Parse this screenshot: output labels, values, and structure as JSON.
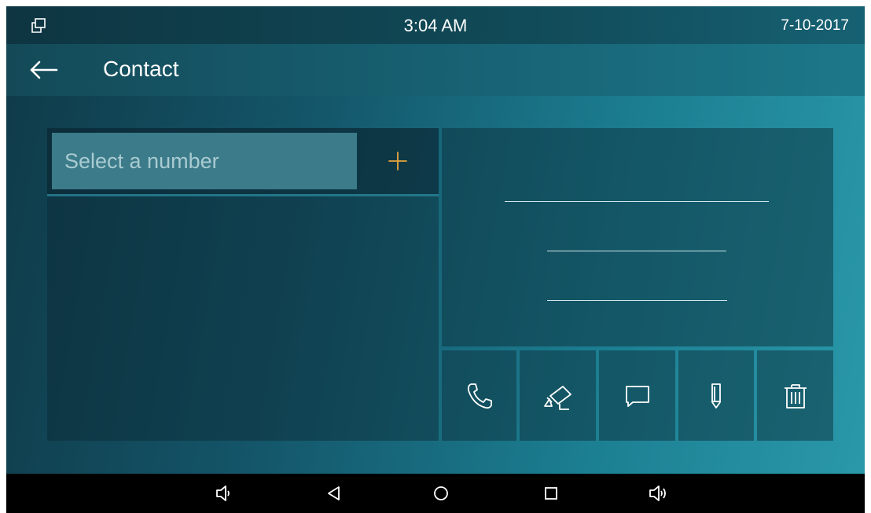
{
  "status_bar": {
    "window_icon": "window-restore-icon",
    "time": "3:04 AM",
    "date": "7-10-2017"
  },
  "title_bar": {
    "back_icon": "arrow-left-icon",
    "title": "Contact"
  },
  "search": {
    "placeholder": "Select a number",
    "value": "",
    "add_icon": "plus-icon",
    "add_color": "#e8a53a"
  },
  "contact_list": {
    "items": []
  },
  "detail": {
    "name": "",
    "number": "",
    "group": ""
  },
  "actions": [
    {
      "id": "call",
      "icon": "phone-icon"
    },
    {
      "id": "monitor",
      "icon": "camera-icon"
    },
    {
      "id": "message",
      "icon": "message-icon"
    },
    {
      "id": "edit",
      "icon": "pencil-icon"
    },
    {
      "id": "delete",
      "icon": "trash-icon"
    }
  ],
  "nav_bar": {
    "buttons": [
      "volume-down-icon",
      "back-triangle-icon",
      "home-circle-icon",
      "recents-square-icon",
      "volume-up-icon"
    ]
  },
  "colors": {
    "accent": "#e8a53a",
    "nav_background": "#000000",
    "text": "#ffffff"
  }
}
